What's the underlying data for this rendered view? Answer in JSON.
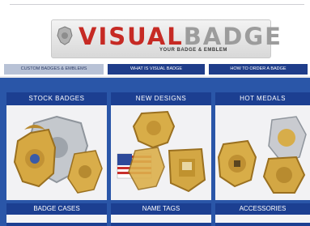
{
  "logo": {
    "word_visual": "VISUAL",
    "word_badge": "BADGE",
    "tagline": "YOUR BADGE & EMBLEM"
  },
  "nav": {
    "items": [
      {
        "label": "CUSTOM BADGES & EMBLEMS"
      },
      {
        "label": "WHAT IS VISUAL BADGE"
      },
      {
        "label": "HOW TO ORDER A BADGE"
      }
    ]
  },
  "tiles": [
    {
      "title": "STOCK BADGES",
      "image": "stock-badges-photo"
    },
    {
      "title": "NEW DESIGNS",
      "image": "new-designs-photo"
    },
    {
      "title": "HOT MEDALS",
      "image": "hot-medals-photo"
    }
  ],
  "row2": [
    {
      "title": "BADGE CASES"
    },
    {
      "title": "NAME TAGS"
    },
    {
      "title": "ACCESSORIES"
    }
  ],
  "colors": {
    "brand_red": "#c62a24",
    "brand_gray": "#9c9c9c",
    "nav_blue": "#1f3d8a",
    "grid_blue": "#2a56a8",
    "gold": "#d4a640",
    "silver": "#bfc3c8"
  }
}
